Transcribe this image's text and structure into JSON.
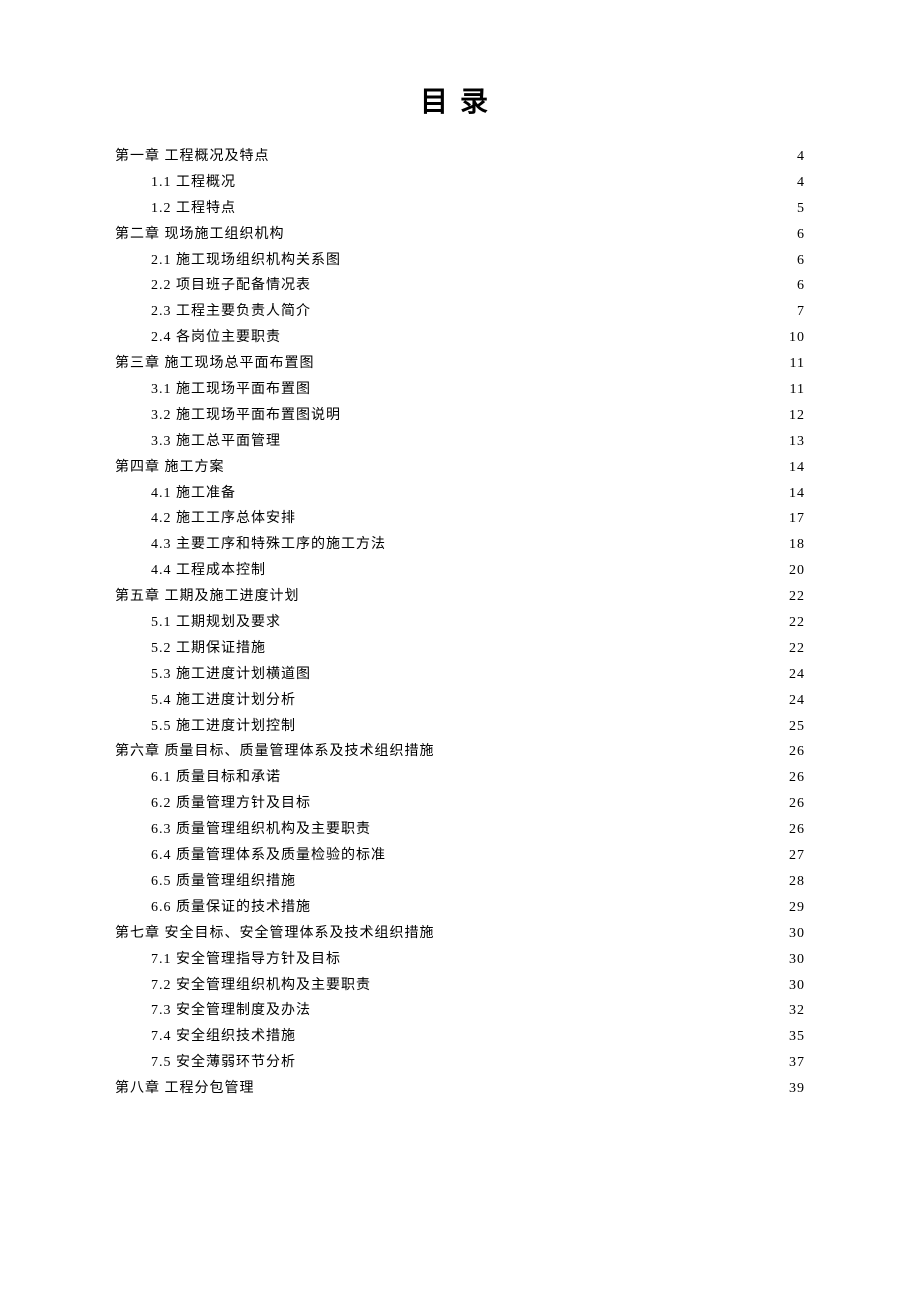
{
  "title": "目录",
  "toc": [
    {
      "level": 1,
      "text": "第一章 工程概况及特点",
      "page": "4"
    },
    {
      "level": 2,
      "text": "1.1 工程概况",
      "page": "4"
    },
    {
      "level": 2,
      "text": "1.2 工程特点",
      "page": "5"
    },
    {
      "level": 1,
      "text": "第二章 现场施工组织机构",
      "page": "6"
    },
    {
      "level": 2,
      "text": "2.1 施工现场组织机构关系图",
      "page": "6"
    },
    {
      "level": 2,
      "text": "2.2 项目班子配备情况表",
      "page": "6"
    },
    {
      "level": 2,
      "text": "2.3 工程主要负责人简介",
      "page": "7"
    },
    {
      "level": 2,
      "text": "2.4 各岗位主要职责",
      "page": "10"
    },
    {
      "level": 1,
      "text": "第三章 施工现场总平面布置图",
      "page": "11"
    },
    {
      "level": 2,
      "text": "3.1 施工现场平面布置图",
      "page": "11"
    },
    {
      "level": 2,
      "text": "3.2 施工现场平面布置图说明",
      "page": "12"
    },
    {
      "level": 2,
      "text": "3.3 施工总平面管理",
      "page": "13"
    },
    {
      "level": 1,
      "text": "第四章 施工方案",
      "page": "14"
    },
    {
      "level": 2,
      "text": "4.1 施工准备",
      "page": "14"
    },
    {
      "level": 2,
      "text": "4.2 施工工序总体安排",
      "page": "17"
    },
    {
      "level": 2,
      "text": "4.3 主要工序和特殊工序的施工方法",
      "page": "18"
    },
    {
      "level": 2,
      "text": "4.4 工程成本控制",
      "page": "20"
    },
    {
      "level": 1,
      "text": "第五章 工期及施工进度计划",
      "page": "22"
    },
    {
      "level": 2,
      "text": "5.1 工期规划及要求",
      "page": "22"
    },
    {
      "level": 2,
      "text": "5.2 工期保证措施",
      "page": "22"
    },
    {
      "level": 2,
      "text": "5.3 施工进度计划横道图",
      "page": "24"
    },
    {
      "level": 2,
      "text": "5.4 施工进度计划分析",
      "page": "24"
    },
    {
      "level": 2,
      "text": "5.5 施工进度计划控制",
      "page": "25"
    },
    {
      "level": 1,
      "text": "第六章 质量目标、质量管理体系及技术组织措施",
      "page": "26"
    },
    {
      "level": 2,
      "text": "6.1 质量目标和承诺",
      "page": "26"
    },
    {
      "level": 2,
      "text": "6.2 质量管理方针及目标",
      "page": "26"
    },
    {
      "level": 2,
      "text": "6.3 质量管理组织机构及主要职责",
      "page": "26"
    },
    {
      "level": 2,
      "text": "6.4 质量管理体系及质量检验的标准",
      "page": "27"
    },
    {
      "level": 2,
      "text": "6.5 质量管理组织措施",
      "page": "28"
    },
    {
      "level": 2,
      "text": "6.6 质量保证的技术措施",
      "page": "29"
    },
    {
      "level": 1,
      "text": "第七章 安全目标、安全管理体系及技术组织措施",
      "page": "30"
    },
    {
      "level": 2,
      "text": "7.1 安全管理指导方针及目标",
      "page": "30"
    },
    {
      "level": 2,
      "text": "7.2 安全管理组织机构及主要职责",
      "page": "30"
    },
    {
      "level": 2,
      "text": "7.3 安全管理制度及办法",
      "page": "32"
    },
    {
      "level": 2,
      "text": "7.4 安全组织技术措施",
      "page": "35"
    },
    {
      "level": 2,
      "text": "7.5 安全薄弱环节分析",
      "page": "37"
    },
    {
      "level": 1,
      "text": "第八章 工程分包管理",
      "page": "39"
    }
  ]
}
